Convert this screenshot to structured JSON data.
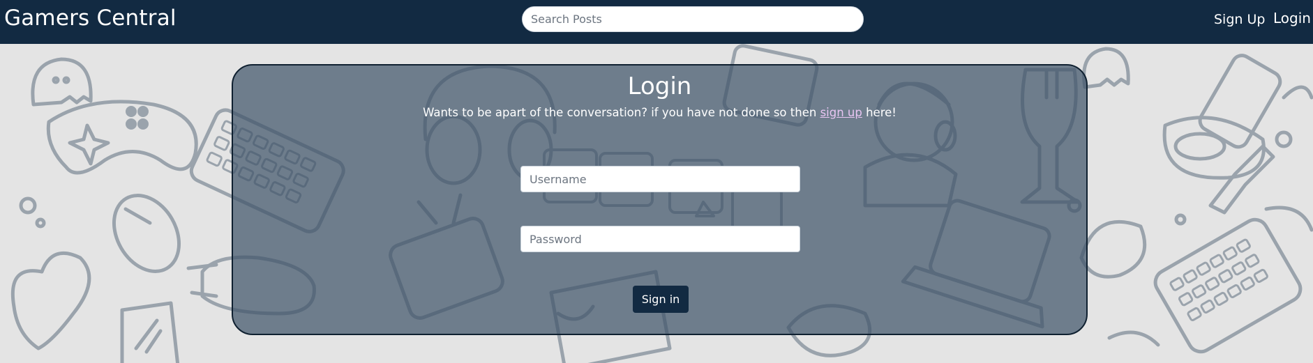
{
  "navbar": {
    "brand": "Gamers Central",
    "search_placeholder": "Search Posts",
    "signup_label": "Sign Up",
    "login_label": "Login"
  },
  "login_card": {
    "title": "Login",
    "subtitle_before": "Wants to be apart of the conversation? if you have not done so then ",
    "subtitle_link": "sign up",
    "subtitle_after": " here!",
    "username_placeholder": "Username",
    "password_placeholder": "Password",
    "submit_label": "Sign in"
  },
  "colors": {
    "navbar_bg": "#122a42",
    "page_bg": "#e4e4e4",
    "card_bg": "#5b6f83",
    "link_accent": "#e8c5f2",
    "doodle_stroke": "#9aa3ac"
  },
  "background_doodles": [
    "ghost-icon",
    "gamepad-icon",
    "keyboard-icon",
    "mouse-icon",
    "heart-icon",
    "headset-icon",
    "retro-tv-icon",
    "laptop-icon",
    "trophy-icon",
    "vr-headset-icon",
    "phone-icon",
    "sword-icon",
    "dpad-icon",
    "gamer-girl-icon"
  ]
}
